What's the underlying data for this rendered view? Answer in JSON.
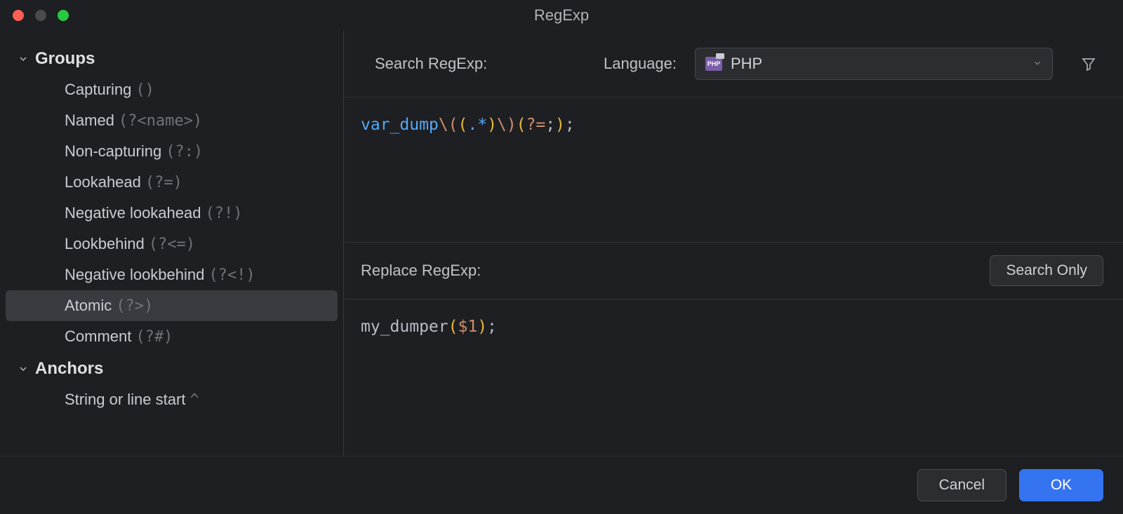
{
  "window": {
    "title": "RegExp"
  },
  "sidebar": {
    "groups": [
      {
        "label": "Groups",
        "expanded": true,
        "items": [
          {
            "label": "Capturing",
            "syntax": "()",
            "selected": false
          },
          {
            "label": "Named",
            "syntax": "(?<name>)",
            "selected": false
          },
          {
            "label": "Non-capturing",
            "syntax": "(?:)",
            "selected": false
          },
          {
            "label": "Lookahead",
            "syntax": "(?=)",
            "selected": false
          },
          {
            "label": "Negative lookahead",
            "syntax": "(?!)",
            "selected": false
          },
          {
            "label": "Lookbehind",
            "syntax": "(?<=)",
            "selected": false
          },
          {
            "label": "Negative lookbehind",
            "syntax": "(?<!)",
            "selected": false
          },
          {
            "label": "Atomic",
            "syntax": "(?>)",
            "selected": true
          },
          {
            "label": "Comment",
            "syntax": "(?#)",
            "selected": false
          }
        ]
      },
      {
        "label": "Anchors",
        "expanded": true,
        "items": [
          {
            "label": "String or line start",
            "syntax": "^",
            "selected": false
          }
        ]
      }
    ]
  },
  "toolbar": {
    "search_label": "Search RegExp:",
    "language_label": "Language:",
    "language_value": "PHP"
  },
  "search_regexp": {
    "tokens": [
      {
        "t": "var_dump",
        "c": "ident"
      },
      {
        "t": "\\(",
        "c": "esc"
      },
      {
        "t": "(",
        "c": "brack"
      },
      {
        "t": ".",
        "c": "op"
      },
      {
        "t": "*",
        "c": "op"
      },
      {
        "t": ")",
        "c": "brack"
      },
      {
        "t": "\\)",
        "c": "esc"
      },
      {
        "t": "(",
        "c": "brack"
      },
      {
        "t": "?=",
        "c": "pipe"
      },
      {
        "t": ";",
        "c": "plain"
      },
      {
        "t": ")",
        "c": "brack"
      },
      {
        "t": ";",
        "c": "plain"
      }
    ]
  },
  "replace_bar": {
    "label": "Replace RegExp:",
    "search_only": "Search Only"
  },
  "replace_regexp": {
    "tokens": [
      {
        "t": "my_dumper",
        "c": "fn"
      },
      {
        "t": "(",
        "c": "brack"
      },
      {
        "t": "$1",
        "c": "var"
      },
      {
        "t": ")",
        "c": "brack"
      },
      {
        "t": ";",
        "c": "punc"
      }
    ]
  },
  "footer": {
    "cancel": "Cancel",
    "ok": "OK"
  }
}
